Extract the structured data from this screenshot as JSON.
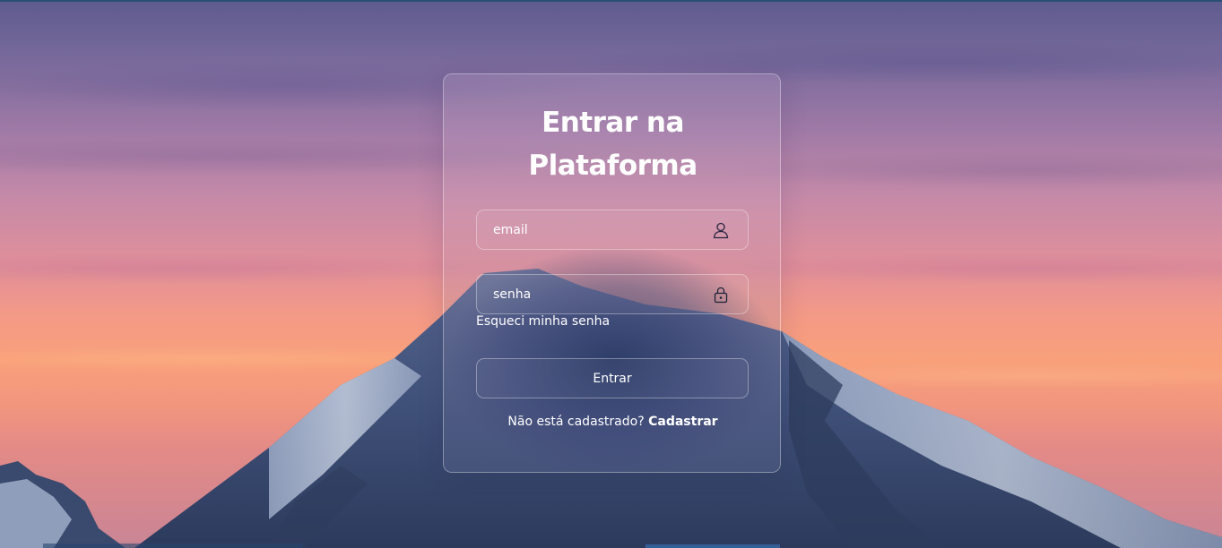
{
  "login": {
    "title_line1": "Entrar na",
    "title_line2": "Plataforma",
    "email": {
      "placeholder": "email",
      "value": "",
      "icon": "user-icon"
    },
    "password": {
      "placeholder": "senha",
      "value": "",
      "icon": "lock-icon"
    },
    "forgot_password": "Esqueci minha senha",
    "submit_label": "Entrar",
    "register_prompt": "Não está cadastrado?",
    "register_link": "Cadastrar"
  },
  "colors": {
    "text": "#ffffff",
    "sky_top": "#5e5b8f",
    "sky_mid": "#c58aa8",
    "sky_horizon": "#f9a07a",
    "mountain_shadow": "#2f3f63",
    "mountain_snow": "#b8c6dc"
  }
}
